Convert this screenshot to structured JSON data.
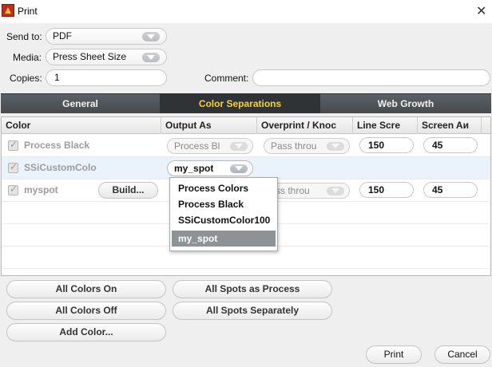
{
  "window": {
    "title": "Print"
  },
  "settings": {
    "send_to_label": "Send to:",
    "send_to_value": "PDF",
    "media_label": "Media:",
    "media_value": "Press Sheet Size",
    "copies_label": "Copies:",
    "copies_value": "1",
    "comment_label": "Comment:",
    "comment_value": ""
  },
  "tabs": [
    {
      "label": "General",
      "active": false
    },
    {
      "label": "Color Separations",
      "active": true
    },
    {
      "label": "Web Growth",
      "active": false
    }
  ],
  "table": {
    "columns": [
      "Color",
      "Output As",
      "Overprint / Knoc",
      "Line Scre",
      "Screen Aи"
    ],
    "rows": [
      {
        "name": "Process Black",
        "output": "Process Bl",
        "overprint": "Pass throu",
        "line_screen": "150",
        "screen_angle": "45"
      },
      {
        "name": "SSiCustomColo",
        "output": "my_spot",
        "overprint": "",
        "line_screen": "",
        "screen_angle": ""
      },
      {
        "name": "myspot",
        "build_label": "Build...",
        "output": "",
        "overprint": "ss throu",
        "line_screen": "150",
        "screen_angle": "45"
      }
    ]
  },
  "output_dropdown": {
    "options": [
      "Process Colors",
      "Process Black",
      "SSiCustomColor100",
      "my_spot"
    ],
    "highlighted": "my_spot"
  },
  "buttons": {
    "all_colors_on": "All Colors On",
    "all_spots_as_process": "All Spots as Process",
    "all_colors_off": "All Colors Off",
    "all_spots_separately": "All Spots Separately",
    "add_color": "Add Color...",
    "print": "Print",
    "cancel": "Cancel"
  },
  "colors": {
    "tab_active_text": "#f4d23a",
    "tab_bar": "#4f5458",
    "selected_row": "#eaf3fb",
    "dropdown_highlight": "#8d9296"
  }
}
